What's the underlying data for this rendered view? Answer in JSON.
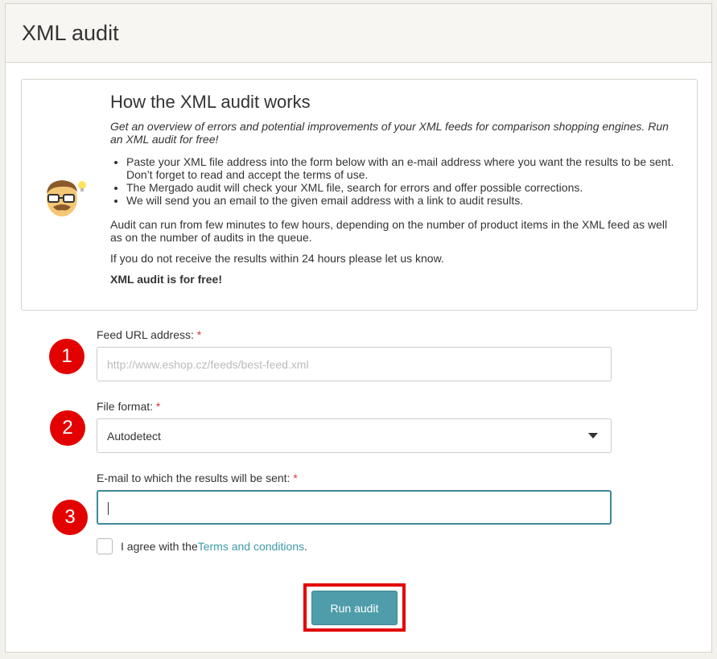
{
  "page": {
    "title": "XML audit"
  },
  "info": {
    "title": "How the XML audit works",
    "intro": "Get an overview of errors and potential improvements of your XML feeds for comparison shopping engines. Run an XML audit for free!",
    "bullets": [
      "Paste your XML file address into the form below with an e-mail address where you want the results to be sent. Don’t forget to read and accept the terms of use.",
      "The Mergado audit will check your XML file, search for errors and offer possible corrections.",
      "We will send you an email to the given email address with a link to audit results."
    ],
    "para1": "Audit can run from few minutes to few hours, depending on the number of product items in the XML feed as well as on the number of audits in the queue.",
    "para2": "If you do not receive the results within 24 hours please let us know.",
    "bold_note": "XML audit is for free!",
    "mascot_icon": "nerd-mascot-icon"
  },
  "markers": [
    "1",
    "2",
    "3"
  ],
  "form": {
    "feed_url": {
      "label": "Feed URL address:",
      "required": "*",
      "placeholder": "http://www.eshop.cz/feeds/best-feed.xml",
      "value": ""
    },
    "file_format": {
      "label": "File format:",
      "required": "*",
      "selected": "Autodetect"
    },
    "email": {
      "label": "E-mail to which the results will be sent:",
      "required": "*",
      "value": ""
    },
    "agree": {
      "prefix": "I agree with the ",
      "link": "Terms and conditions",
      "suffix": ".",
      "checked": false
    },
    "submit_label": "Run audit"
  },
  "colors": {
    "accent": "#4f9daa",
    "link": "#3c9aa8",
    "marker": "#e30000",
    "required": "#d9363e"
  }
}
